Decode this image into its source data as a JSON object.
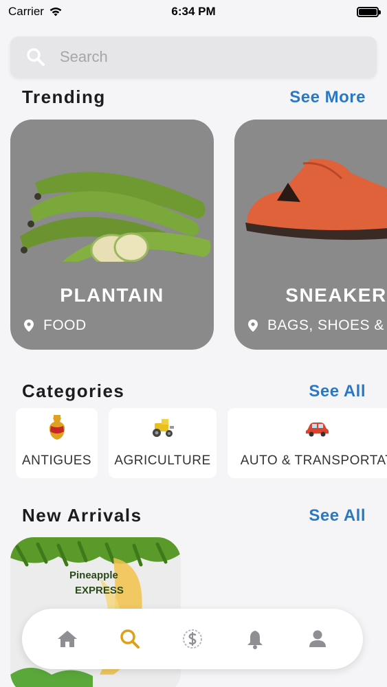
{
  "status_bar": {
    "carrier": "Carrier",
    "time": "6:34 PM",
    "battery_level": 1.0
  },
  "search": {
    "placeholder": "Search",
    "icon": "search-icon"
  },
  "trending": {
    "title": "Trending",
    "link": "See More",
    "items": [
      {
        "name": "PLANTAIN",
        "category": "FOOD"
      },
      {
        "name": "SNEAKER",
        "category": "BAGS, SHOES &"
      }
    ]
  },
  "categories": {
    "title": "Categories",
    "link": "See All",
    "items": [
      {
        "label": "ANTIGUES",
        "icon": "vase-icon"
      },
      {
        "label": "AGRICULTURE",
        "icon": "tractor-icon"
      },
      {
        "label": "AUTO & TRANSPORTAT",
        "icon": "car-icon"
      }
    ]
  },
  "new_arrivals": {
    "title": "New Arrivals",
    "link": "See All",
    "items": [
      {
        "text_line1": "Pineapple",
        "text_line2": "EXPRESS"
      }
    ]
  },
  "bottom_nav": {
    "active": "search",
    "items": [
      {
        "id": "home",
        "icon": "home-icon"
      },
      {
        "id": "search",
        "icon": "search-icon"
      },
      {
        "id": "sell",
        "icon": "dollar-circle-icon"
      },
      {
        "id": "notifications",
        "icon": "bell-icon"
      },
      {
        "id": "profile",
        "icon": "user-icon"
      }
    ]
  },
  "colors": {
    "accent": "#2a78c4",
    "nav_active": "#e0a015",
    "nav_inactive": "#8e8e93",
    "card_bg": "#8a8a8a"
  }
}
